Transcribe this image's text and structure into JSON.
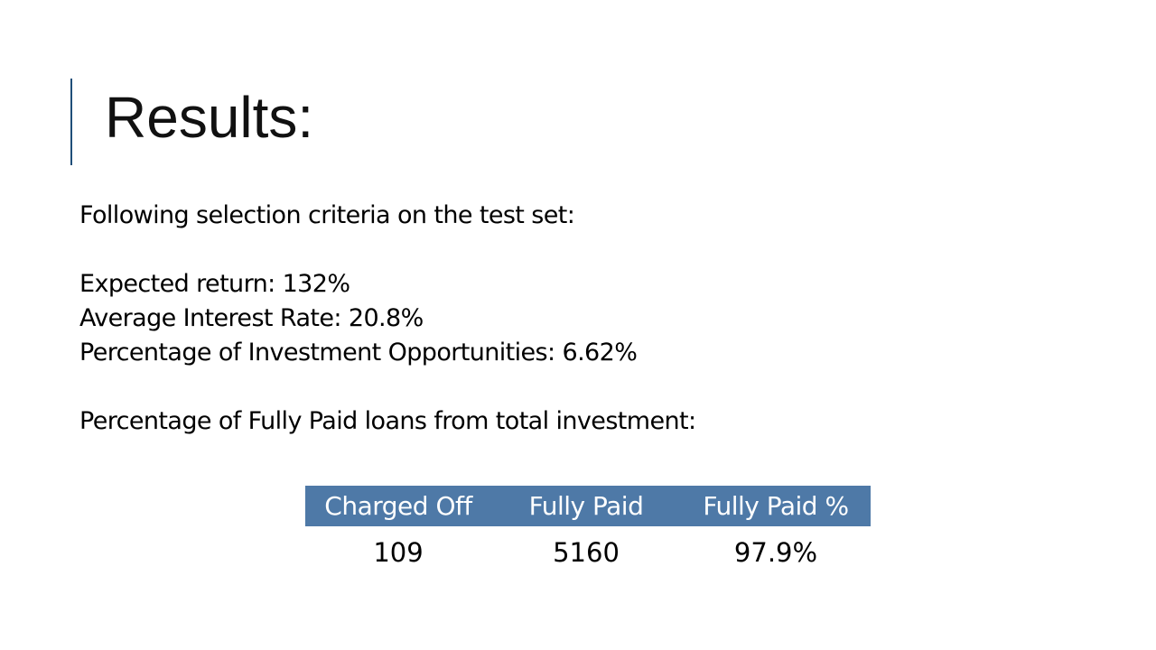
{
  "slide": {
    "title": "Results:",
    "lines": {
      "intro": "Following selection criteria on the test set:",
      "expected_return": "Expected return: 132%",
      "avg_interest": "Average Interest Rate: 20.8%",
      "pct_opportunities": "Percentage of Investment Opportunities: 6.62%",
      "fully_paid_heading": "Percentage of Fully Paid loans from total investment:"
    },
    "table": {
      "headers": [
        "Charged Off",
        "Fully Paid",
        "Fully Paid %"
      ],
      "row": [
        "109",
        "5160",
        "97.9%"
      ]
    }
  },
  "colors": {
    "accent_bar": "#1f4e79",
    "table_header_bg": "#4e79a7"
  }
}
